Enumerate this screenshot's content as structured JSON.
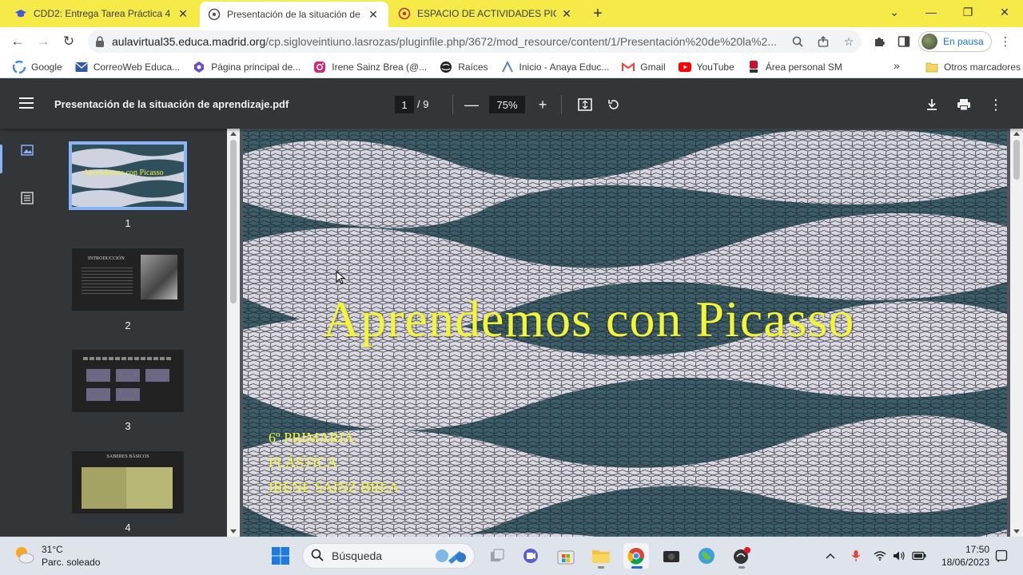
{
  "tabs": [
    {
      "label": "CDD2: Entrega Tarea Práctica 4 -",
      "active": false
    },
    {
      "label": "Presentación de la situación de a",
      "active": true
    },
    {
      "label": "ESPACIO DE ACTIVIDADES PICAS",
      "active": false
    }
  ],
  "address": {
    "host": "aulavirtual35.educa.madrid.org",
    "path": "/cp.sigloveintiuno.lasrozas/pluginfile.php/3672/mod_resource/content/1/Presentación%20de%20la%2..."
  },
  "profile": {
    "status": "En pausa"
  },
  "bookmarks": [
    {
      "label": "Google",
      "icon": "google-icon"
    },
    {
      "label": "CorreoWeb Educa...",
      "icon": "mail-icon"
    },
    {
      "label": "Página principal de...",
      "icon": "site-icon"
    },
    {
      "label": "Irene Sainz Brea (@...",
      "icon": "instagram-icon"
    },
    {
      "label": "Raíces",
      "icon": "globe-icon"
    },
    {
      "label": "Inicio - Anaya Educ...",
      "icon": "anaya-icon"
    },
    {
      "label": "Gmail",
      "icon": "gmail-icon"
    },
    {
      "label": "YouTube",
      "icon": "youtube-icon"
    },
    {
      "label": "Área personal SM",
      "icon": "sm-icon"
    }
  ],
  "bookmarks_more": "»",
  "bookmarks_other": "Otros marcadores",
  "pdf": {
    "filename": "Presentación de la situación de aprendizaje.pdf",
    "current_page": "1",
    "total_pages": "/ 9",
    "zoom": "75%"
  },
  "thumbnails": [
    {
      "number": "1",
      "title": "Aprendemos con Picasso",
      "selected": true
    },
    {
      "number": "2",
      "title": "INTRODUCCIÓN",
      "selected": false
    },
    {
      "number": "3",
      "title": "",
      "selected": false
    },
    {
      "number": "4",
      "title": "SABERES BÁSICOS",
      "selected": false
    }
  ],
  "slide": {
    "title": "Aprendemos con Picasso",
    "lines": [
      "6º PRIMARIA",
      "PLÁSTICA",
      "IRENE SAINZ BREA"
    ]
  },
  "taskbar": {
    "temperature": "31°C",
    "weather": "Parc. soleado",
    "search": "Búsqueda",
    "time": "17:50",
    "date": "18/06/2023"
  },
  "colors": {
    "tabstrip": "#f6ea49",
    "pdf_toolbar": "#323639",
    "slide_text": "#f2f53a",
    "selection": "#8ab4f8"
  }
}
